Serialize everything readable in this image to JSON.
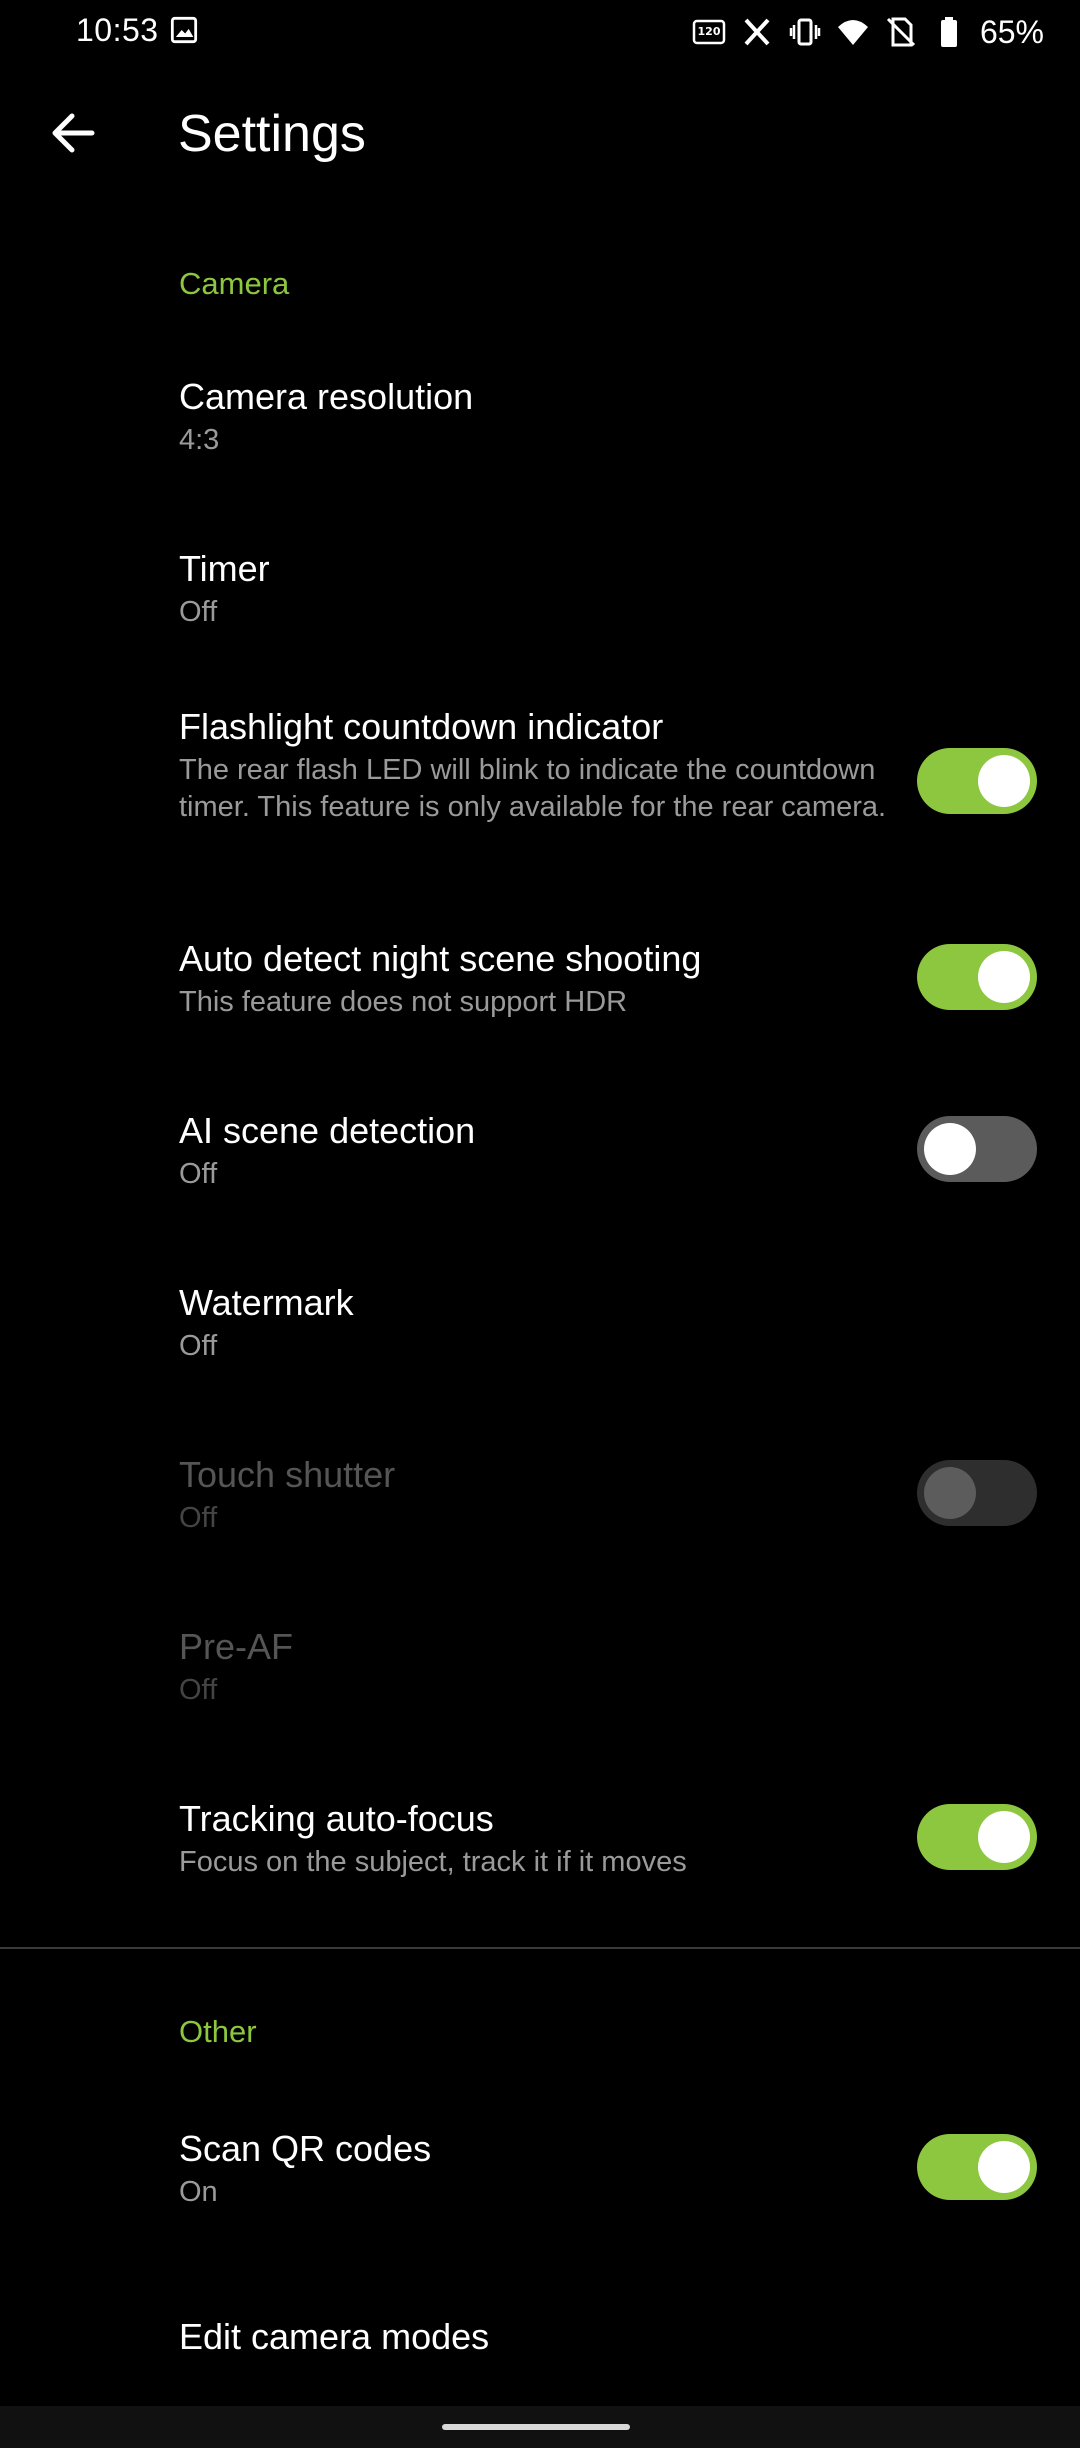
{
  "status_bar": {
    "time": "10:53",
    "battery_percent": "65%",
    "icons": [
      "gallery-icon",
      "120hz-icon",
      "x-icon",
      "vibrate-icon",
      "wifi-icon",
      "no-sim-icon",
      "battery-icon"
    ]
  },
  "app_bar": {
    "title": "Settings"
  },
  "colors": {
    "accent": "#8dc63f",
    "background": "#000000",
    "toggle_off": "#5b5b5b"
  },
  "sections": {
    "camera": {
      "header": "Camera",
      "items": [
        {
          "title": "Camera resolution",
          "subtitle": "4:3"
        },
        {
          "title": "Timer",
          "subtitle": "Off"
        },
        {
          "title": "Flashlight countdown indicator",
          "subtitle": "The rear flash LED will blink to indicate the countdown timer. This feature is only available for the rear camera.",
          "toggle": "on"
        },
        {
          "title": "Auto detect night scene shooting",
          "subtitle": "This feature does not support HDR",
          "toggle": "on"
        },
        {
          "title": "AI scene detection",
          "subtitle": "Off",
          "toggle": "off"
        },
        {
          "title": "Watermark",
          "subtitle": "Off"
        },
        {
          "title": "Touch shutter",
          "subtitle": "Off",
          "toggle": "off",
          "disabled": true
        },
        {
          "title": "Pre-AF",
          "subtitle": "Off",
          "disabled": true
        },
        {
          "title": "Tracking auto-focus",
          "subtitle": "Focus on the subject, track it if it moves",
          "toggle": "on"
        }
      ]
    },
    "other": {
      "header": "Other",
      "items": [
        {
          "title": "Scan QR codes",
          "subtitle": "On",
          "toggle": "on"
        },
        {
          "title": "Edit camera modes"
        }
      ]
    }
  }
}
